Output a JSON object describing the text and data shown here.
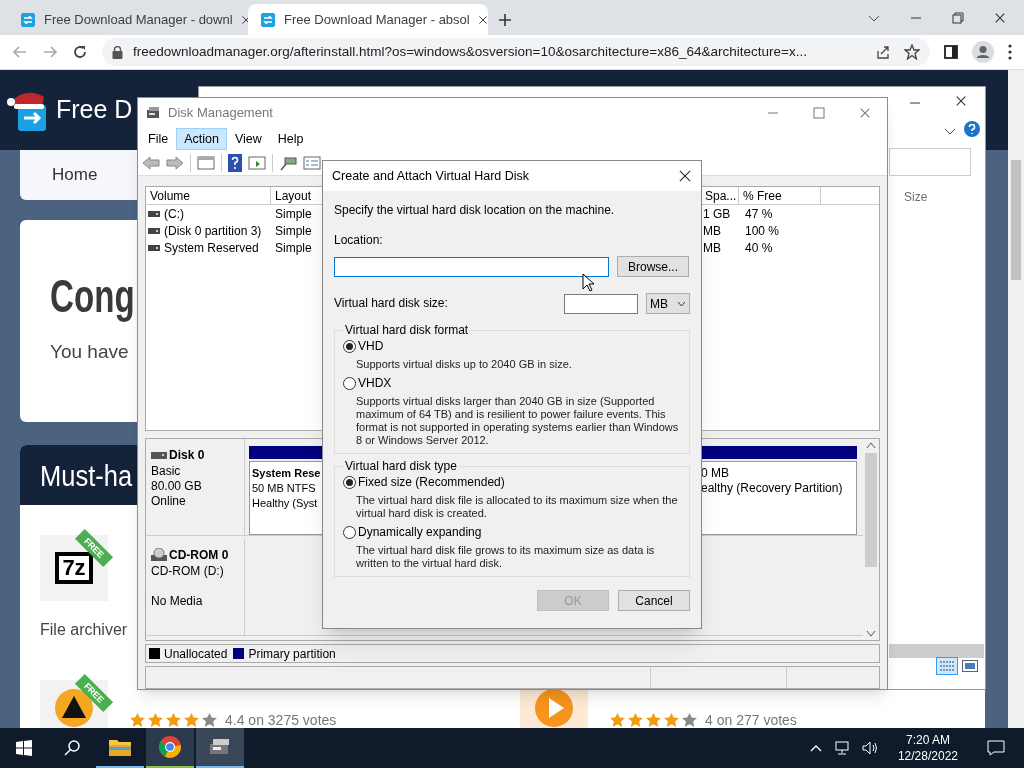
{
  "browser": {
    "tabs": [
      {
        "title": "Free Download Manager - downl",
        "selected": false
      },
      {
        "title": "Free Download Manager - absol",
        "selected": true
      }
    ],
    "url": "freedownloadmanager.org/afterinstall.html?os=windows&osversion=10&osarchitecture=x86_64&architecture=x..."
  },
  "webpage": {
    "logo": "Free D",
    "nav": [
      "Home"
    ],
    "heading": "Cong",
    "intro": "You have",
    "section_title": "Must-ha",
    "apps": [
      {
        "badge": "FREE",
        "icon_text": "7z",
        "subtitle": "File archiver"
      },
      {
        "badge": "FREE",
        "stars": 4,
        "votes": "4.4 on 3275 votes"
      },
      {
        "stars": 4,
        "votes": "4 on 277 votes"
      }
    ]
  },
  "explorer": {
    "column": "Size"
  },
  "disk_management": {
    "title": "Disk Management",
    "menu": [
      {
        "label": "File",
        "selected": false
      },
      {
        "label": "Action",
        "selected": true
      },
      {
        "label": "View",
        "selected": false
      },
      {
        "label": "Help",
        "selected": false
      }
    ],
    "volume_columns": [
      "Volume",
      "Layout",
      "Spa...",
      "% Free"
    ],
    "volumes": [
      {
        "volume": "(C:)",
        "layout": "Simple",
        "free_space": "1 GB",
        "percent_free": "47 %"
      },
      {
        "volume": "(Disk 0 partition 3)",
        "layout": "Simple",
        "free_space": "MB",
        "percent_free": "100 %"
      },
      {
        "volume": "System Reserved",
        "layout": "Simple",
        "free_space": "MB",
        "percent_free": "40 %"
      }
    ],
    "disks": [
      {
        "kind": "disk",
        "name": "Disk 0",
        "details": [
          "Basic",
          "80.00 GB",
          "Online"
        ],
        "partitions": [
          {
            "lines": [
              "System Rese",
              "50 MB NTFS",
              "Healthy (Syst"
            ]
          },
          {
            "lines": [
              "0 MB",
              "ealthy (Recovery Partition)"
            ]
          }
        ]
      },
      {
        "kind": "cdrom",
        "name": "CD-ROM 0",
        "details": [
          "CD-ROM (D:)",
          "No Media"
        ]
      }
    ],
    "legend": [
      {
        "label": "Unallocated",
        "color": "#000000"
      },
      {
        "label": "Primary partition",
        "color": "#000080"
      }
    ]
  },
  "dialog": {
    "title": "Create and Attach Virtual Hard Disk",
    "instruction": "Specify the virtual hard disk location on the machine.",
    "location_label": "Location:",
    "browse": "Browse...",
    "size_label": "Virtual hard disk size:",
    "unit": "MB",
    "groups": [
      {
        "title": "Virtual hard disk format",
        "options": [
          {
            "label": "VHD",
            "selected": true,
            "description": "Supports virtual disks up to 2040 GB in size."
          },
          {
            "label": "VHDX",
            "selected": false,
            "description": "Supports virtual disks larger than 2040 GB in size (Supported maximum of 64 TB) and is resilient to power failure events. This format is not supported in operating systems earlier than Windows 8 or Windows Server 2012."
          }
        ]
      },
      {
        "title": "Virtual hard disk type",
        "options": [
          {
            "label": "Fixed size (Recommended)",
            "selected": true,
            "description": "The virtual hard disk file is allocated to its maximum size when the virtual hard disk is created."
          },
          {
            "label": "Dynamically expanding",
            "selected": false,
            "description": "The virtual hard disk file grows to its maximum size as data is written to the virtual hard disk."
          }
        ]
      }
    ],
    "buttons": [
      {
        "label": "OK",
        "disabled": true
      },
      {
        "label": "Cancel",
        "disabled": false
      }
    ]
  },
  "taskbar": {
    "time": "7:20 AM",
    "date": "12/28/2022"
  }
}
